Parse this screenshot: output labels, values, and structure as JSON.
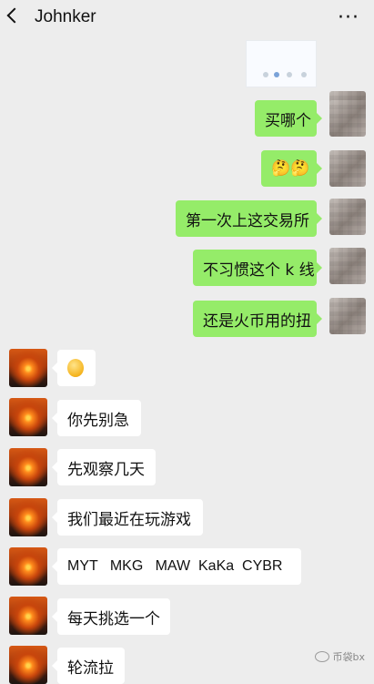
{
  "header": {
    "title": "Johnker"
  },
  "messages_me": [
    {
      "text": "买哪个"
    },
    {
      "text": "🤔🤔"
    },
    {
      "text": "第一次上这交易所"
    },
    {
      "text": "不习惯这个 k 线"
    },
    {
      "text": "还是火币用的扭"
    }
  ],
  "messages_other": [
    {
      "text": ""
    },
    {
      "text": "你先别急"
    },
    {
      "text": "先观察几天"
    },
    {
      "text": "我们最近在玩游戏"
    },
    {
      "text": "MYT   MKG   MAW  KaKa  CYBR"
    },
    {
      "text": "每天挑选一个"
    },
    {
      "text": "轮流拉"
    }
  ],
  "watermark": {
    "text": "币袋bx"
  },
  "colors": {
    "background": "#ededed",
    "my_bubble": "#95ec69",
    "other_bubble": "#ffffff"
  }
}
